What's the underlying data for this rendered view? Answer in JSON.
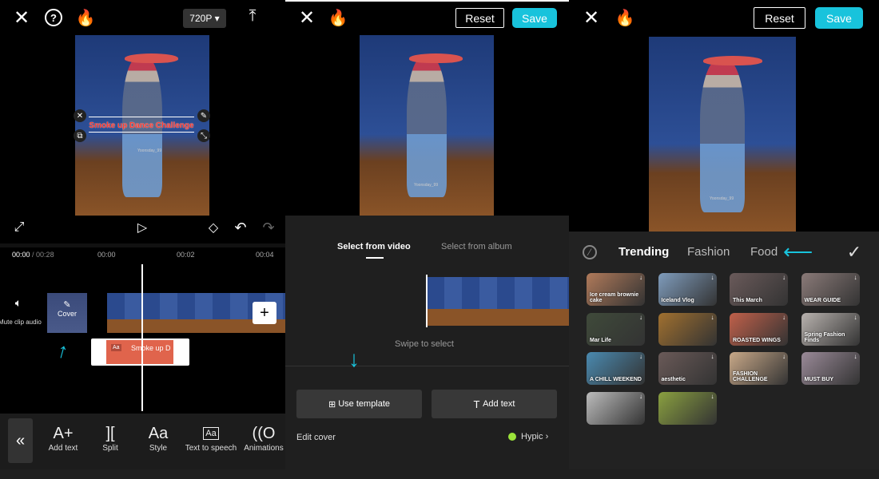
{
  "panel1": {
    "resolution": "720P",
    "caption_text": "Smoke up Dance Challenge",
    "watermark": "Yoonsday_99",
    "time_current": "00:00",
    "time_total": "/ 00:28",
    "ruler": [
      "00:00",
      "00:02",
      "00:04"
    ],
    "mute_label": "Mute clip audio",
    "cover_label": "Cover",
    "text_clip_label": "Smoke up D",
    "tools": [
      {
        "icon": "A+",
        "label": "Add text"
      },
      {
        "icon": "][",
        "label": "Split"
      },
      {
        "icon": "Aa",
        "label": "Style"
      },
      {
        "icon": "Aa",
        "label": "Text to speech"
      },
      {
        "icon": "((O",
        "label": "Animations"
      }
    ]
  },
  "panel2": {
    "reset": "Reset",
    "save": "Save",
    "watermark": "Yoonsday_99",
    "tabs": [
      "Select from video",
      "Select from album"
    ],
    "active_tab": 0,
    "swipe_hint": "Swipe to select",
    "use_template": "Use template",
    "add_text": "Add text",
    "edit_cover": "Edit cover",
    "hypic": "Hypic"
  },
  "panel3": {
    "reset": "Reset",
    "save": "Save",
    "watermark": "Yoonsday_99",
    "categories": [
      "Trending",
      "Fashion",
      "Food"
    ],
    "active_category": 0,
    "templates": [
      {
        "title": "Ice cream brownie cake",
        "color": "#b07a5a"
      },
      {
        "title": "Iceland Vlog",
        "color": "#7f9cbc"
      },
      {
        "title": "This March",
        "color": "#6a5a5a"
      },
      {
        "title": "WEAR GUIDE",
        "color": "#8a7a78"
      },
      {
        "title": "Mar Life",
        "color": "#3f4a3a"
      },
      {
        "title": "",
        "color": "#a0702f"
      },
      {
        "title": "ROASTED WINGS",
        "color": "#c0604a"
      },
      {
        "title": "Spring Fashion Finds",
        "color": "#b8b2ae"
      },
      {
        "title": "A CHILL WEEKEND",
        "color": "#4a8ab0"
      },
      {
        "title": "aesthetic",
        "color": "#6a5a58"
      },
      {
        "title": "FASHION CHALLENGE",
        "color": "#c8a888"
      },
      {
        "title": "MUST BUY",
        "color": "#9a8a98"
      },
      {
        "title": "",
        "color": "#bcbcbc"
      },
      {
        "title": "",
        "color": "#8aa040"
      }
    ]
  },
  "colors": {
    "accent": "#18c3dc",
    "text_clip": "#e0644c",
    "hypic_dot": "#9be33a"
  }
}
